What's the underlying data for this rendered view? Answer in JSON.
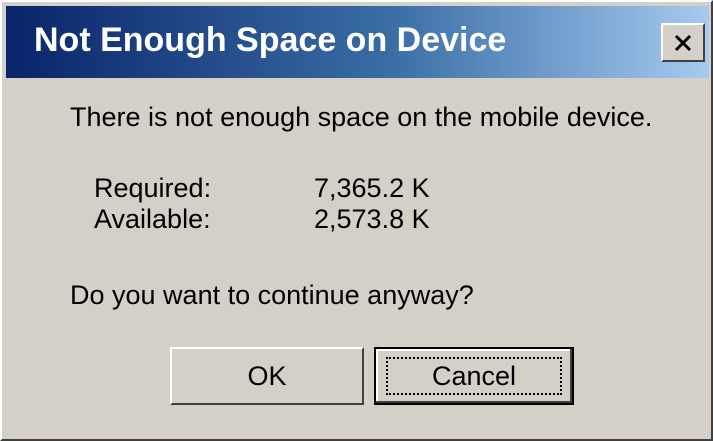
{
  "window": {
    "title": "Not Enough Space on Device",
    "close_icon": "close-icon"
  },
  "content": {
    "message": "There is not enough space on the mobile device.",
    "details": [
      {
        "label": "Required:",
        "value": "7,365.2 K"
      },
      {
        "label": "Available:",
        "value": "2,573.8 K"
      }
    ],
    "question": "Do you want to continue anyway?"
  },
  "buttons": {
    "ok_label": "OK",
    "cancel_label": "Cancel"
  },
  "colors": {
    "titlebar_start": "#0a246a",
    "titlebar_end": "#a6caf0",
    "dialog_bg": "#d4d0c8"
  }
}
